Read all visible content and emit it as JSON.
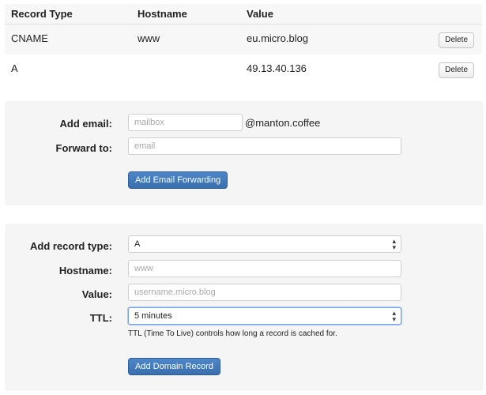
{
  "table": {
    "headers": {
      "type": "Record Type",
      "hostname": "Hostname",
      "value": "Value"
    },
    "rows": [
      {
        "type": "CNAME",
        "hostname": "www",
        "value": "eu.micro.blog",
        "delete_label": "Delete"
      },
      {
        "type": "A",
        "hostname": "",
        "value": "49.13.40.136",
        "delete_label": "Delete"
      }
    ]
  },
  "email_form": {
    "add_email_label": "Add email:",
    "mailbox_placeholder": "mailbox",
    "domain_suffix": "@manton.coffee",
    "forward_label": "Forward to:",
    "forward_placeholder": "email",
    "submit_label": "Add Email Forwarding"
  },
  "domain_form": {
    "record_type_label": "Add record type:",
    "record_type_value": "A",
    "hostname_label": "Hostname:",
    "hostname_placeholder": "www",
    "value_label": "Value:",
    "value_placeholder": "username.micro.blog",
    "ttl_label": "TTL:",
    "ttl_value": "5 minutes",
    "ttl_help": "TTL (Time To Live) controls how long a record is cached for.",
    "submit_label": "Add Domain Record"
  },
  "colors": {
    "primary": "#3f77b9",
    "panel_bg": "#f5f5f5"
  },
  "icons": {
    "select": "chevron-updown-icon"
  }
}
